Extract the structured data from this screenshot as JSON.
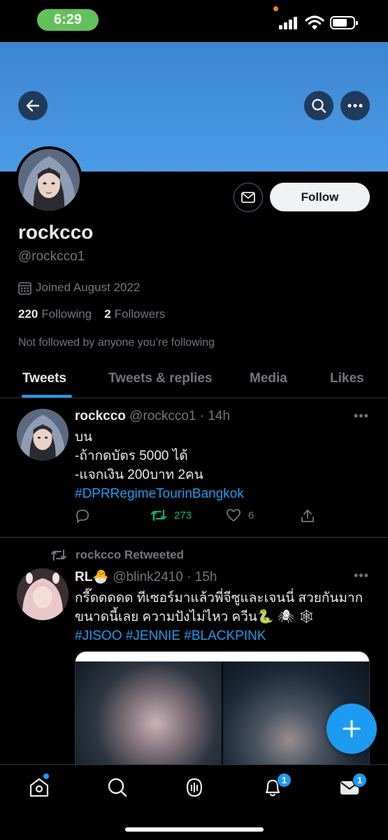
{
  "status_bar": {
    "time": "6:29"
  },
  "profile": {
    "name": "rockcco",
    "handle": "@rockcco1",
    "joined": "Joined August 2022",
    "following_count": "220",
    "following_label": "Following",
    "followers_count": "2",
    "followers_label": "Followers",
    "not_followed_text": "Not followed by anyone you’re following",
    "follow_label": "Follow"
  },
  "tabs": [
    "Tweets",
    "Tweets & replies",
    "Media",
    "Likes"
  ],
  "tweets": [
    {
      "name": "rockcco",
      "meta": "@rockcco1 · 14h",
      "lines": [
        "บน",
        "-ถ้ากดบัตร 5000 ได้",
        "-แจกเงิน 200บาท 2คน"
      ],
      "hashtag": "#DPRRegimeTourinBangkok",
      "retweets": "273",
      "likes": "6"
    },
    {
      "retweeted_by": "rockcco Retweeted",
      "name": "RL🐣",
      "meta": "@blink2410 · 15h",
      "lines": [
        "กรี๊ดดดดด ทีเซอร์มาแล้วพี่จีซูและเจนนี่ สวยกันมาก",
        "ขนาดนี้เลย ความปังไม่ไหว ควีน🐍 🕷 🕸"
      ],
      "hashtags": "#JISOO #JENNIE #BLACKPINK"
    }
  ],
  "badges": {
    "notifications": "1",
    "messages": "1"
  },
  "colors": {
    "accent": "#1d9bf0",
    "banner": "#4c9be6",
    "retweet_green": "#00ba7c",
    "status_green": "#62c15a"
  }
}
